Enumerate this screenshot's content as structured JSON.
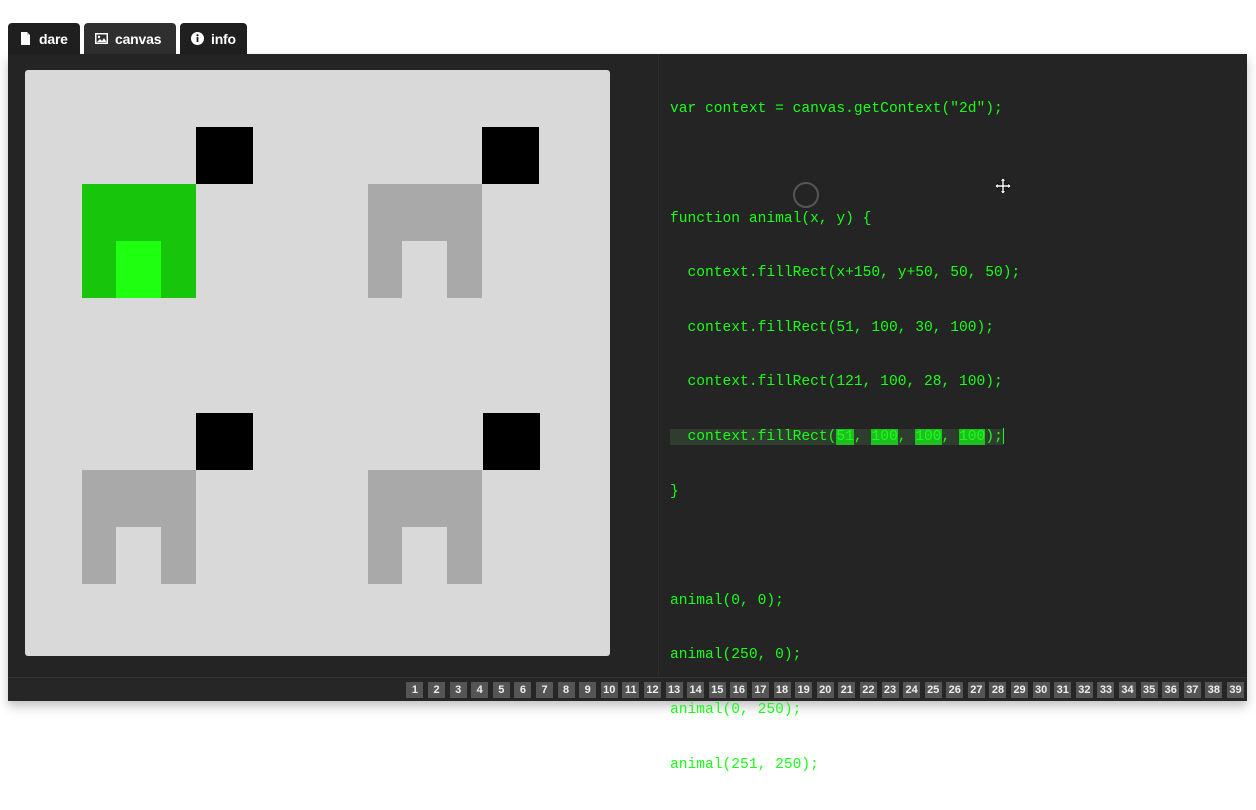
{
  "tabs": [
    {
      "label": "dare",
      "icon": "file-icon"
    },
    {
      "label": "canvas",
      "icon": "image-icon"
    },
    {
      "label": "info",
      "icon": "info-icon"
    }
  ],
  "code": {
    "lines": [
      "var context = canvas.getContext(\"2d\");",
      "",
      "function animal(x, y) {",
      "  context.fillRect(x+150, y+50, 50, 50);",
      "  context.fillRect(51, 100, 30, 100);",
      "  context.fillRect(121, 100, 28, 100);",
      "  context.fillRect(51, 100, 100, 100);",
      "}",
      "",
      "animal(0, 0);",
      "animal(250, 0);",
      "animal(0, 250);",
      "animal(251, 250);"
    ],
    "selected_line_parts": [
      "  context.fillRect(",
      "51",
      ", ",
      "100",
      ", ",
      "100",
      ", ",
      "100",
      ");"
    ]
  },
  "colors": {
    "code_text": "#19ff19",
    "animal_gray": "#a9a9a9",
    "animal_green": "#17c60b",
    "animal_green_light": "#1fff10",
    "head": "#000000",
    "canvas_bg": "#d9d9d9"
  },
  "animals": [
    {
      "id": "top-left",
      "style": "green"
    },
    {
      "id": "top-right",
      "style": "gray"
    },
    {
      "id": "bottom-left",
      "style": "gray"
    },
    {
      "id": "bottom-right",
      "style": "gray"
    }
  ],
  "pages": [
    "1",
    "2",
    "3",
    "4",
    "5",
    "6",
    "7",
    "8",
    "9",
    "10",
    "11",
    "12",
    "13",
    "14",
    "15",
    "16",
    "17",
    "18",
    "19",
    "20",
    "21",
    "22",
    "23",
    "24",
    "25",
    "26",
    "27",
    "28",
    "29",
    "30",
    "31",
    "32",
    "33",
    "34",
    "35",
    "36",
    "37",
    "38",
    "39"
  ]
}
